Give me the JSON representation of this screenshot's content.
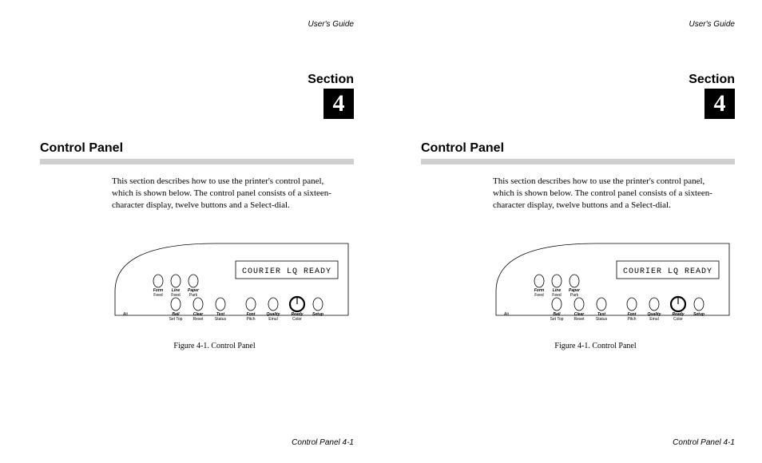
{
  "header": "User's Guide",
  "section_label": "Section",
  "section_number": "4",
  "title": "Control Panel",
  "intro": "This section describes how to use the printer's control panel, which is shown below.  The control panel consists of a sixteen-character display, twelve buttons and a Select-dial.",
  "display_text": "COURIER LQ READY",
  "buttons_top": [
    {
      "top": "Form",
      "bot": "Feed"
    },
    {
      "top": "Line",
      "bot": "Feed"
    },
    {
      "top": "Paper",
      "bot": "Park"
    }
  ],
  "alt_label": "Alt",
  "buttons_bottom": [
    {
      "top": "Bail",
      "bot": "Set Top"
    },
    {
      "top": "Clear",
      "bot": "Reset"
    },
    {
      "top": "Test",
      "bot": "Status"
    },
    {
      "top": "Font",
      "bot": "Pitch"
    },
    {
      "top": "Quality",
      "bot": "Emul"
    },
    {
      "top": "Ready",
      "bot": "Color"
    },
    {
      "top": "Setup",
      "bot": ""
    }
  ],
  "caption": "Figure 4-1.  Control Panel",
  "footer": "Control Panel  4-1"
}
